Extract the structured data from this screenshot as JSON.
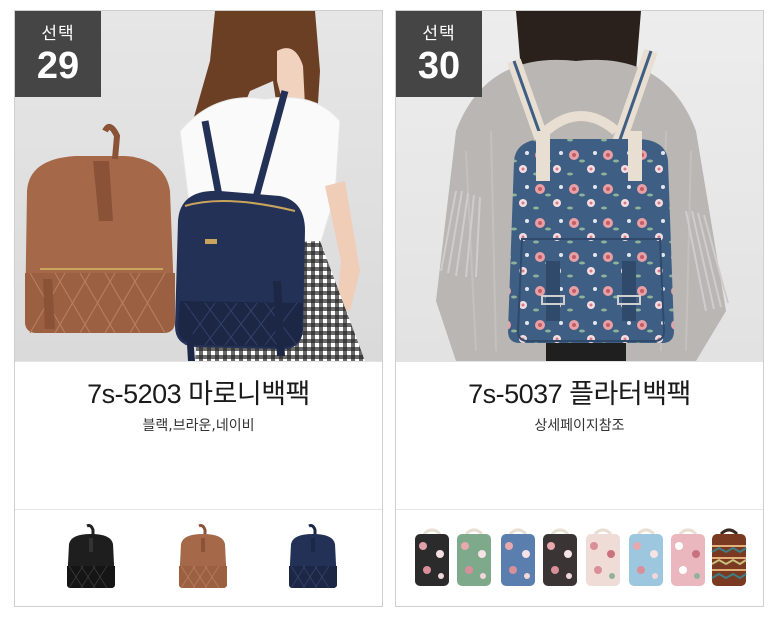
{
  "products": [
    {
      "badge_word": "선택",
      "badge_number": "29",
      "name": "7s-5203 마로니백팩",
      "colors": "블랙,브라운,네이비",
      "thumbnails": [
        "black-backpack",
        "brown-backpack",
        "navy-backpack"
      ]
    },
    {
      "badge_word": "선택",
      "badge_number": "30",
      "name": "7s-5037 플라터백팩",
      "colors": "상세페이지참조",
      "thumbnails": [
        "floral-black",
        "floral-green",
        "floral-blue",
        "floral-dark",
        "floral-pink",
        "floral-sky",
        "floral-rose",
        "aztec-brown"
      ]
    }
  ],
  "colors": {
    "badge_bg": "#454545",
    "brown": "#a5694a",
    "navy": "#243156",
    "floral_navy": "#3e5e84"
  }
}
